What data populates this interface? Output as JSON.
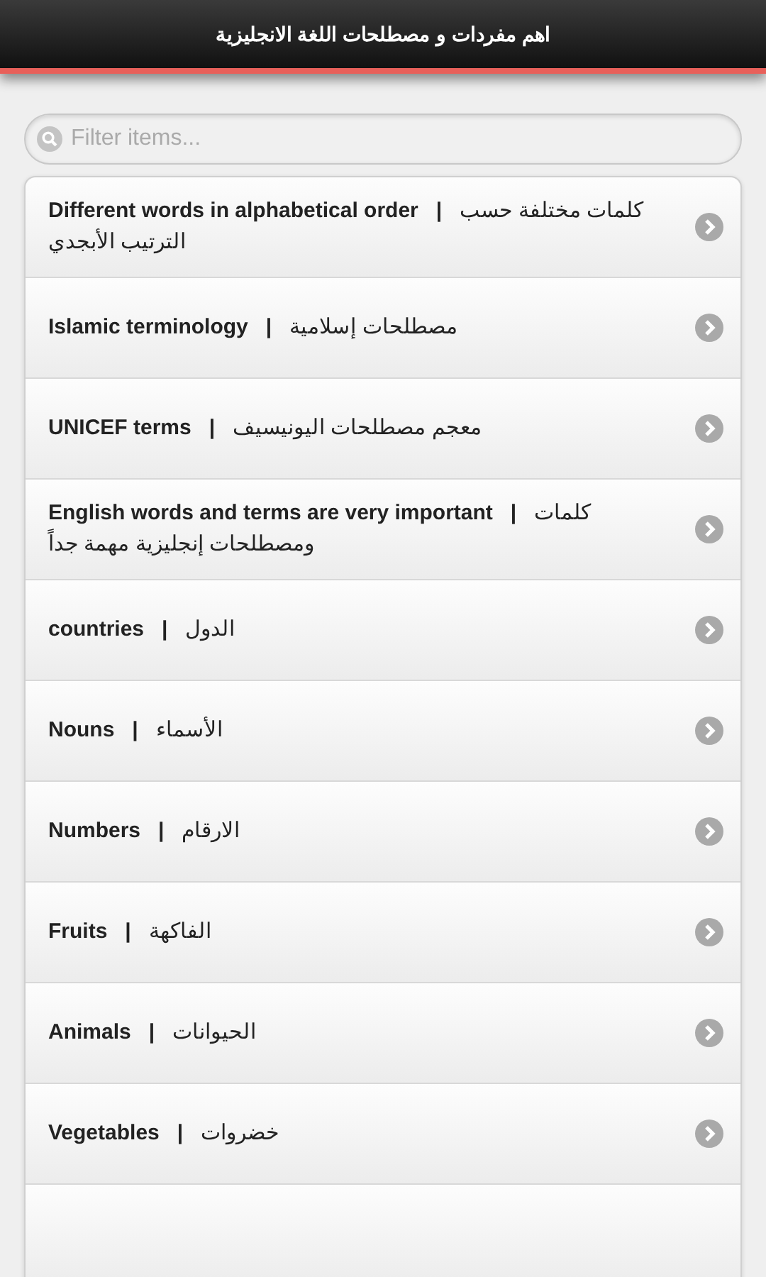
{
  "header": {
    "title": "اهم مفردات و مصطلحات اللغة الانجليزية"
  },
  "search": {
    "placeholder": "Filter items..."
  },
  "items": [
    {
      "label": "**Different words in alphabetical order   |**   كلمات مختلفة حسب الترتيب الأبجدي"
    },
    {
      "label": "**Islamic terminology   |**   مصطلحات إسلامية"
    },
    {
      "label": "**UNICEF terms   |**   معجم مصطلحات اليونيسيف"
    },
    {
      "label": "**English words and terms are very important   |**   كلمات ومصطلحات إنجليزية مهمة جداً"
    },
    {
      "label": "**countries   |**   الدول"
    },
    {
      "label": "**Nouns   |**   الأسماء"
    },
    {
      "label": "**Numbers   |**   الارقام"
    },
    {
      "label": "**Fruits   |**   الفاكهة"
    },
    {
      "label": "**Animals   |**   الحيوانات"
    },
    {
      "label": "**Vegetables   |**   خضروات"
    }
  ]
}
